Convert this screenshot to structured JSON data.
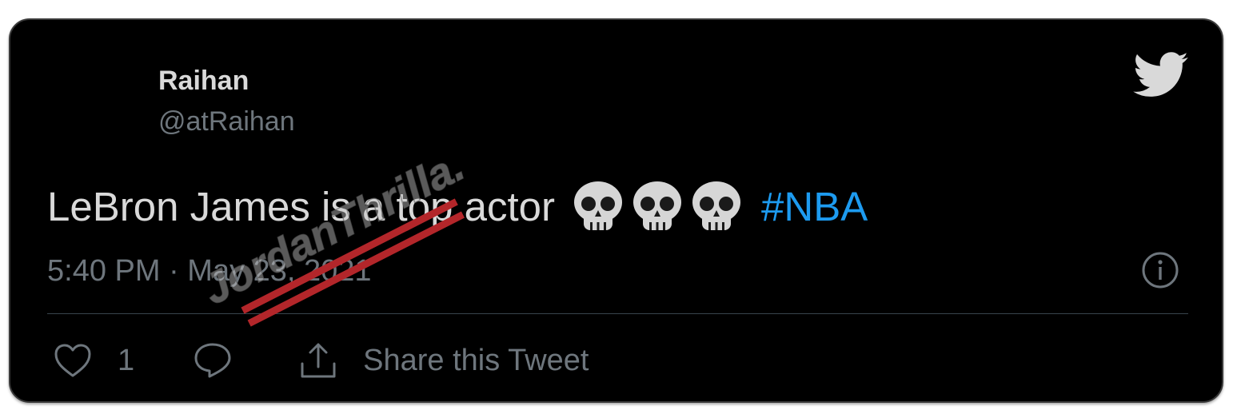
{
  "tweet": {
    "display_name": "Raihan",
    "handle": "@atRaihan",
    "text": "LeBron James is a top actor",
    "emoji": [
      "skull-emoji",
      "skull-emoji",
      "skull-emoji"
    ],
    "hashtag": "#NBA",
    "timestamp": "5:40 PM · May 23, 2021"
  },
  "actions": {
    "like_count": "1",
    "share_label": "Share this Tweet"
  },
  "icons": {
    "brand": "twitter-bird-icon",
    "info": "info-icon",
    "like": "heart-icon",
    "reply": "reply-icon",
    "share": "share-icon"
  },
  "watermark": {
    "text": "JordanThrilla."
  },
  "colors": {
    "background": "#000000",
    "text": "#d9d9d9",
    "muted": "#6e767d",
    "hashtag": "#1d9bf0",
    "watermark_stripe": "#b3262a"
  }
}
